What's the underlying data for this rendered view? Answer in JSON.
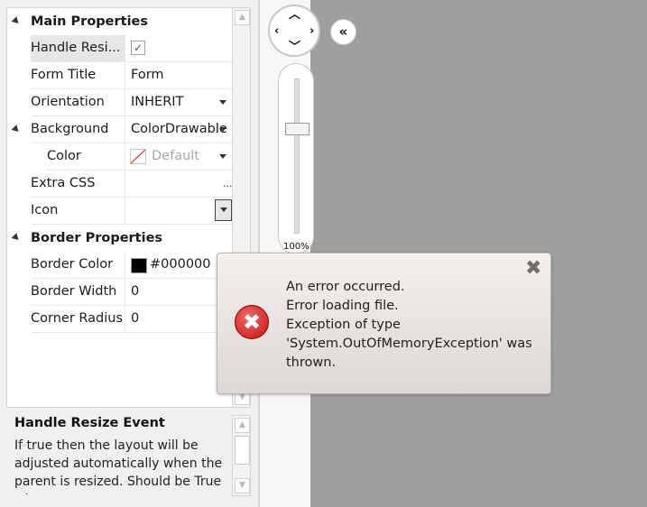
{
  "properties": {
    "main_category": "Main Properties",
    "rows": [
      {
        "label": "Handle Resi...",
        "check": "✓"
      },
      {
        "label": "Form Title",
        "value": "Form"
      },
      {
        "label": "Orientation",
        "value": "INHERIT"
      },
      {
        "label": "Background",
        "value": "ColorDrawable"
      },
      {
        "label": "Color",
        "value": "Default"
      },
      {
        "label": "Extra CSS",
        "value": "..."
      },
      {
        "label": "Icon",
        "value": ""
      }
    ],
    "border_category": "Border Properties",
    "border_rows": [
      {
        "label": "Border Color",
        "value": "#000000"
      },
      {
        "label": "Border Width",
        "value": "0"
      },
      {
        "label": "Corner Radius",
        "value": "0"
      }
    ]
  },
  "description": {
    "title": "Handle Resize Event",
    "text": "If true then the layout will be adjusted automatically when the parent is resized.",
    "text_cut": "Should be True when..."
  },
  "designer": {
    "zoom_label": "100%",
    "collapse_label": "«"
  },
  "error_dialog": {
    "lines": [
      "An error occurred.",
      "Error loading file.",
      "Exception of type",
      "'System.OutOfMemoryException' was",
      "thrown."
    ],
    "close_icon": "close-icon",
    "error_icon": "error-icon"
  },
  "colors": {
    "canvas_bg": "#9f9f9f",
    "border_color_swatch": "#000000",
    "error_red": "#c41010"
  }
}
